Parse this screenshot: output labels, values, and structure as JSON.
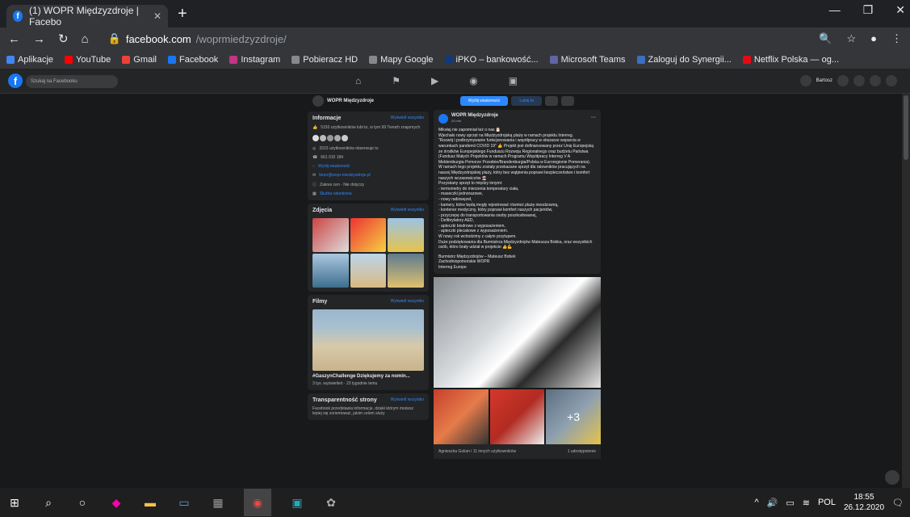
{
  "browser": {
    "tab_title": "(1) WOPR Międzyzdroje | Facebo",
    "url_host": "facebook.com",
    "url_path": "/woprmiedzyzdroje/"
  },
  "bookmarks": [
    "Aplikacje",
    "YouTube",
    "Gmail",
    "Facebook",
    "Instagram",
    "Pobieracz HD",
    "Mapy Google",
    "iPKO – bankowość...",
    "Microsoft Teams",
    "Zaloguj do Synergii...",
    "Netflix Polska — og..."
  ],
  "bookmark_colors": [
    "#4285f4",
    "#ff0000",
    "#ea4335",
    "#1877f2",
    "#c13584",
    "#888888",
    "#888888",
    "#123a7a",
    "#6264a7",
    "#3b6fc1",
    "#e50914"
  ],
  "fb": {
    "search_placeholder": "Szukaj na Facebooku",
    "user": "Bartosz",
    "page_name": "WOPR Międzyzdroje",
    "info_title": "Informacje",
    "see_all": "Wyświetl wszystko",
    "likes_text": "5150 użytkowników lubi to, w tym 99 Twoich znajomych",
    "followers_text": "3315 użytkowników obserwuje to",
    "phone": "661 015 184",
    "send_message": "Wyślij wiadomość",
    "email": "biuro@wopr-miedzyzdroje.pl",
    "hours": "Zakres cen · Nie dotyczy",
    "category": "Służba ratunkowa",
    "photos_title": "Zdjęcia",
    "videos_title": "Filmy",
    "video_caption": "#GaszynChallenge Dziękujemy za nomin...",
    "video_meta": "3 tys. wyświetleń · 23 tygodnie temu",
    "transparency_title": "Transparentność strony",
    "transparency_text": "Facebook przedstawia informacje, dzięki którym możesz lepiej się zorientować, jakim celom służy"
  },
  "actions": {
    "send_message": "Wyślij wiadomość",
    "like": "Lubię to"
  },
  "post": {
    "author": "WOPR Międzyzdroje",
    "time": "20 min",
    "body": "Mikołaj nie zapomniał też o nas 🎅\nWjechało nowy sprzęt na Międzyzdrojską plażę w ramach projektu Interreg.\n\"Rozwój i podtrzymywanie funkcjonowania i współpracy w obszarze wsparcia w warunkach pandemii COVID 19\" 👍 Projekt jest dofinansowany przez Unię Europejską ze środków Europejskiego Funduszu Rozwoju Regionalnego oraz budżetu Państwa (Fundusz Małych Projektów w ramach Programu Współpracy Interreg V A Meklemburgia-Pomorze Przednie/Brandenburgia/Polska w Euroregionie Pomerania).\nW ramach tego projektu zostały przekazane sprzęt dla ratowników pracujących na naszej Międzyzdrojskiej plaży, który bez wątpienia poprawi bezpieczeństwo i komfort naszych wczasowiczów 🏖️\nPozyskany sprzęt to między innymi:\n- termometry do mierzenia temperatury ciała,\n- maseczki jednorazowe,\n- nowy radiowęzeł,\n- kamery, które będą mogły rejestrować również plażę nieodzowną,\n- kontener medyczny, który poprawi komfort naszych pacjentów,\n- przyczepę do transportowania osoby poszkodowanej,\n- Defibrylatory AED,\n- apteczki biodrowe z wyposażeniem,\n- apteczki plecakowe z wyposażeniem.\nW nowy rok wchodzimy z całym przytupem.\nDuże podziękowania dla Burmistrza Międzyzdrojów Mateusza Bobka, oraz wszystkich osób, które brały udział w projekcie 👍💪",
    "tags": "Burmistrz Międzyzdrojów – Mateusz Bobek\nZachodniopomorskie WOPR\nInterreg Europe",
    "more_photos": "+3",
    "reactions": "Agnieszka Golian i 11 innych użytkowników",
    "shares": "1 udostępnienie"
  },
  "taskbar": {
    "lang": "POL",
    "time": "18:55",
    "date": "26.12.2020"
  }
}
